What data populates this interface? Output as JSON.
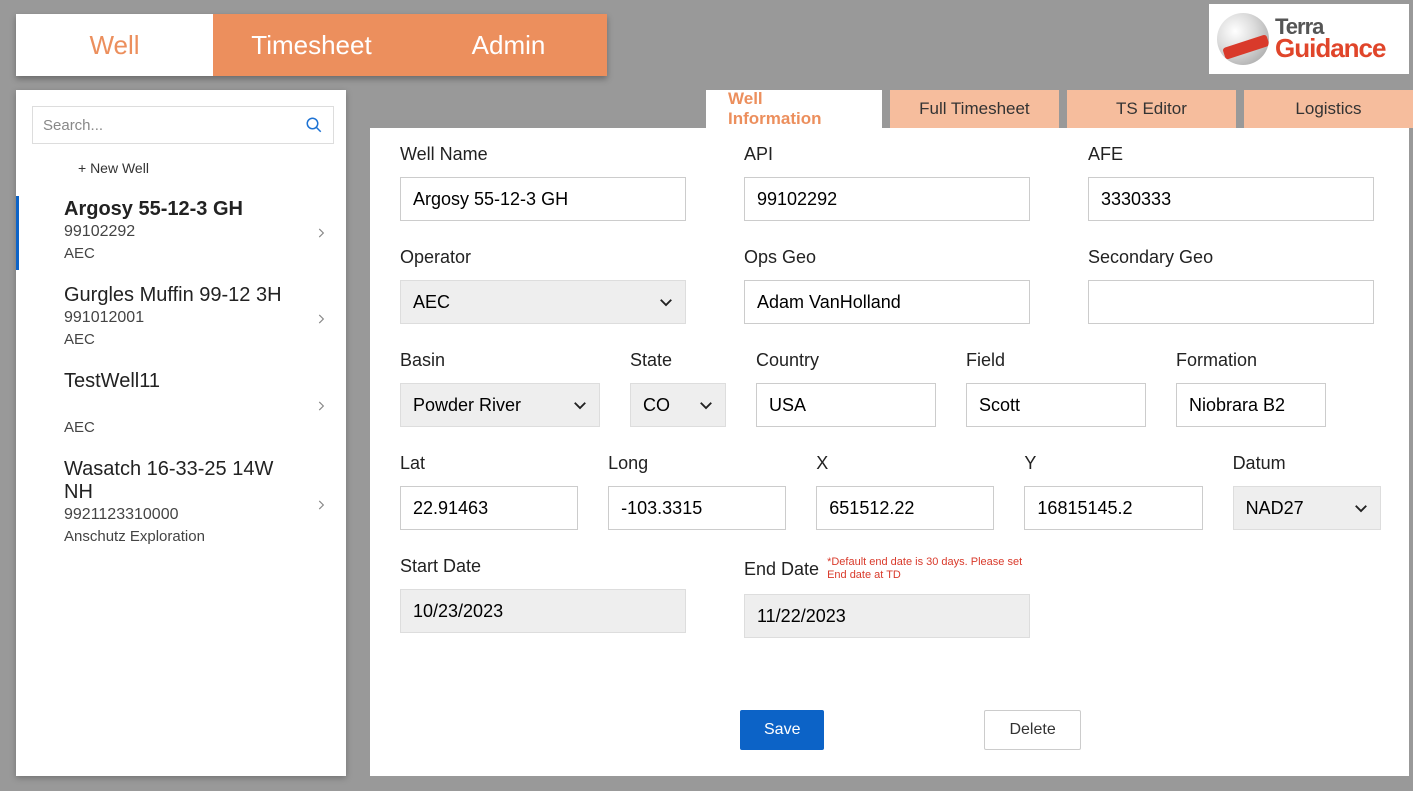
{
  "logo": {
    "line1": "Terra",
    "line2": "Guidance"
  },
  "topTabs": [
    {
      "label": "Well",
      "active": true
    },
    {
      "label": "Timesheet",
      "active": false
    },
    {
      "label": "Admin",
      "active": false
    }
  ],
  "sidebar": {
    "searchPlaceholder": "Search...",
    "newWellLabel": "+ New Well",
    "wells": [
      {
        "name": "Argosy 55-12-3 GH",
        "api": "99102292",
        "operator": "AEC",
        "selected": true
      },
      {
        "name": "Gurgles Muffin 99-12 3H",
        "api": "991012001",
        "operator": "AEC",
        "selected": false
      },
      {
        "name": "TestWell11",
        "api": "",
        "operator": "AEC",
        "selected": false
      },
      {
        "name": "Wasatch 16-33-25 14W NH",
        "api": "9921123310000",
        "operator": "Anschutz Exploration",
        "selected": false
      }
    ]
  },
  "subTabs": [
    {
      "label": "Well Information",
      "active": true
    },
    {
      "label": "Full Timesheet",
      "active": false
    },
    {
      "label": "TS Editor",
      "active": false
    },
    {
      "label": "Logistics",
      "active": false
    }
  ],
  "form": {
    "labels": {
      "wellName": "Well Name",
      "api": "API",
      "afe": "AFE",
      "operator": "Operator",
      "opsGeo": "Ops Geo",
      "secGeo": "Secondary Geo",
      "basin": "Basin",
      "state": "State",
      "country": "Country",
      "field": "Field",
      "formation": "Formation",
      "lat": "Lat",
      "long": "Long",
      "x": "X",
      "y": "Y",
      "datum": "Datum",
      "startDate": "Start Date",
      "endDate": "End Date",
      "save": "Save",
      "delete": "Delete"
    },
    "values": {
      "wellName": "Argosy 55-12-3 GH",
      "api": "99102292",
      "afe": "3330333",
      "operator": "AEC",
      "opsGeo": "Adam VanHolland",
      "secGeo": "",
      "basin": "Powder River",
      "state": "CO",
      "country": "USA",
      "field": "Scott",
      "formation": "Niobrara B2",
      "lat": "22.91463",
      "long": "-103.3315",
      "x": "651512.22",
      "y": "16815145.2",
      "datum": "NAD27",
      "startDate": "10/23/2023",
      "endDate": "11/22/2023"
    },
    "endDateWarning": "*Default end date is 30 days. Please set End date at TD"
  }
}
